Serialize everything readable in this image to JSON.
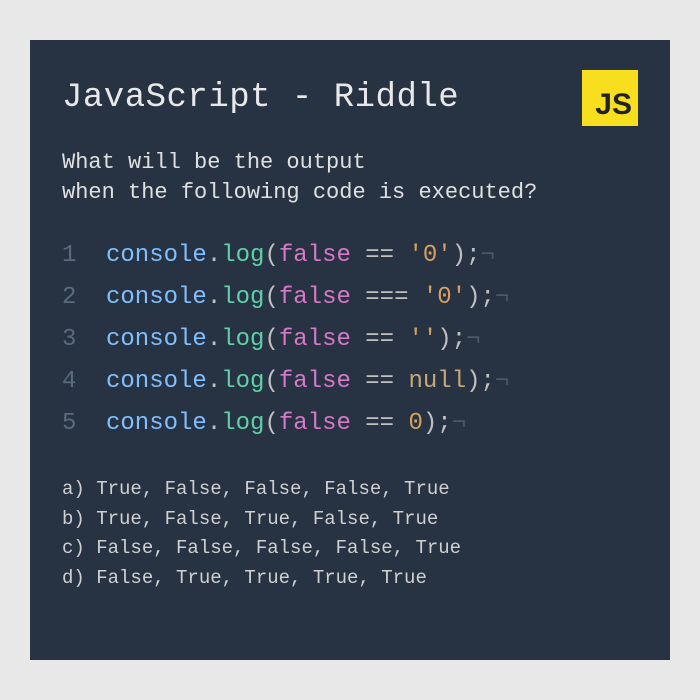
{
  "title": "JavaScript - Riddle",
  "badge": "JS",
  "question_line1": "What will be the output",
  "question_line2": "when the following code is executed?",
  "code": {
    "lines": [
      {
        "num": "1",
        "tokens": [
          {
            "t": "console",
            "c": "tok-obj"
          },
          {
            "t": ".",
            "c": "tok-punct"
          },
          {
            "t": "log",
            "c": "tok-method"
          },
          {
            "t": "(",
            "c": "tok-punct"
          },
          {
            "t": "false",
            "c": "tok-bool"
          },
          {
            "t": " == ",
            "c": "tok-op"
          },
          {
            "t": "'0'",
            "c": "tok-str"
          },
          {
            "t": ");",
            "c": "tok-punct"
          },
          {
            "t": "¬",
            "c": "tok-eol"
          }
        ]
      },
      {
        "num": "2",
        "tokens": [
          {
            "t": "console",
            "c": "tok-obj"
          },
          {
            "t": ".",
            "c": "tok-punct"
          },
          {
            "t": "log",
            "c": "tok-method"
          },
          {
            "t": "(",
            "c": "tok-punct"
          },
          {
            "t": "false",
            "c": "tok-bool"
          },
          {
            "t": " === ",
            "c": "tok-op"
          },
          {
            "t": "'0'",
            "c": "tok-str"
          },
          {
            "t": ");",
            "c": "tok-punct"
          },
          {
            "t": "¬",
            "c": "tok-eol"
          }
        ]
      },
      {
        "num": "3",
        "tokens": [
          {
            "t": "console",
            "c": "tok-obj"
          },
          {
            "t": ".",
            "c": "tok-punct"
          },
          {
            "t": "log",
            "c": "tok-method"
          },
          {
            "t": "(",
            "c": "tok-punct"
          },
          {
            "t": "false",
            "c": "tok-bool"
          },
          {
            "t": " == ",
            "c": "tok-op"
          },
          {
            "t": "''",
            "c": "tok-str"
          },
          {
            "t": ");",
            "c": "tok-punct"
          },
          {
            "t": "¬",
            "c": "tok-eol"
          }
        ]
      },
      {
        "num": "4",
        "tokens": [
          {
            "t": "console",
            "c": "tok-obj"
          },
          {
            "t": ".",
            "c": "tok-punct"
          },
          {
            "t": "log",
            "c": "tok-method"
          },
          {
            "t": "(",
            "c": "tok-punct"
          },
          {
            "t": "false",
            "c": "tok-bool"
          },
          {
            "t": " == ",
            "c": "tok-op"
          },
          {
            "t": "null",
            "c": "tok-null"
          },
          {
            "t": ");",
            "c": "tok-punct"
          },
          {
            "t": "¬",
            "c": "tok-eol"
          }
        ]
      },
      {
        "num": "5",
        "tokens": [
          {
            "t": "console",
            "c": "tok-obj"
          },
          {
            "t": ".",
            "c": "tok-punct"
          },
          {
            "t": "log",
            "c": "tok-method"
          },
          {
            "t": "(",
            "c": "tok-punct"
          },
          {
            "t": "false",
            "c": "tok-bool"
          },
          {
            "t": " == ",
            "c": "tok-op"
          },
          {
            "t": "0",
            "c": "tok-num"
          },
          {
            "t": ");",
            "c": "tok-punct"
          },
          {
            "t": "¬",
            "c": "tok-eol"
          }
        ]
      }
    ]
  },
  "answers": [
    "a) True, False, False, False, True",
    "b) True, False, True, False, True",
    "c) False, False, False, False, True",
    "d) False, True, True, True, True"
  ]
}
